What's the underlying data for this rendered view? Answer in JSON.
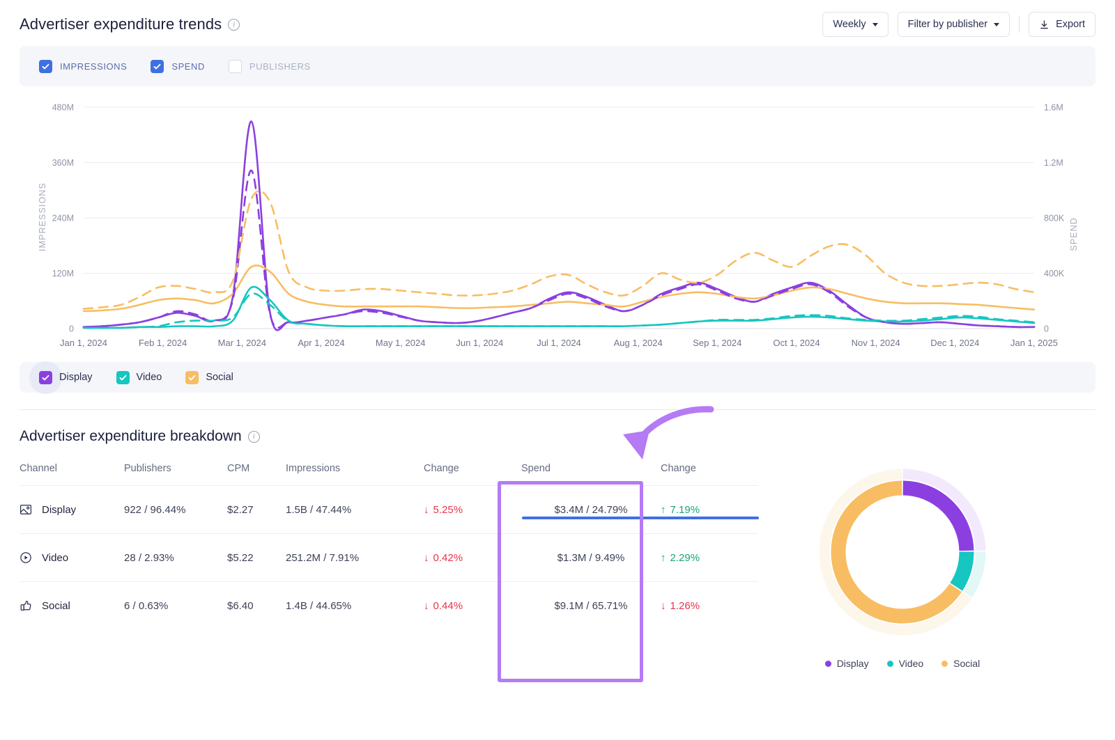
{
  "trends": {
    "title": "Advertiser expenditure trends",
    "info_icon": "info-icon",
    "controls": {
      "period_label": "Weekly",
      "filter_label": "Filter by publisher",
      "export_label": "Export",
      "export_icon": "download-icon"
    },
    "metrics": [
      {
        "label": "IMPRESSIONS",
        "checked": true
      },
      {
        "label": "SPEND",
        "checked": true
      },
      {
        "label": "PUBLISHERS",
        "checked": false
      }
    ],
    "channels": [
      {
        "label": "Display",
        "checked": true,
        "color": "#8b3fe0"
      },
      {
        "label": "Video",
        "checked": true,
        "color": "#16c6c0"
      },
      {
        "label": "Social",
        "checked": true,
        "color": "#f8bd62"
      }
    ]
  },
  "chart_data": {
    "type": "line",
    "title": "Advertiser expenditure trends",
    "xlabel": "",
    "ylabel": "IMPRESSIONS",
    "y2label": "SPEND",
    "grid": true,
    "legend": "bottom",
    "x": [
      "Jan 1, 2024",
      "Feb 1, 2024",
      "Mar 1, 2024",
      "Apr 1, 2024",
      "May 1, 2024",
      "Jun 1, 2024",
      "Jul 1, 2024",
      "Aug 1, 2024",
      "Sep 1, 2024",
      "Oct 1, 2024",
      "Nov 1, 2024",
      "Dec 1, 2024",
      "Jan 1, 2025"
    ],
    "yticks": [
      "0",
      "120M",
      "240M",
      "360M",
      "480M"
    ],
    "ylim": [
      0,
      480000000
    ],
    "y2ticks": [
      "0",
      "400K",
      "800K",
      "1.2M",
      "1.6M"
    ],
    "y2lim": [
      0,
      1600000
    ],
    "series": [
      {
        "name": "Display impressions",
        "axis": "left",
        "style": "solid",
        "color": "#8b3fe0",
        "values": [
          2,
          3,
          5,
          8,
          14,
          20,
          16,
          10,
          40,
          262,
          20,
          8,
          10,
          14,
          18,
          24,
          22,
          16,
          10,
          8,
          7,
          9,
          14,
          20,
          26,
          38,
          46,
          40,
          30,
          22,
          30,
          44,
          52,
          58,
          50,
          40,
          34,
          44,
          52,
          58,
          48,
          30,
          14,
          8,
          6,
          7,
          8,
          6,
          4,
          3,
          2,
          2
        ]
      },
      {
        "name": "Video impressions",
        "axis": "left",
        "style": "solid",
        "color": "#16c6c0",
        "values": [
          1,
          1,
          1,
          2,
          2,
          3,
          3,
          3,
          10,
          52,
          36,
          10,
          6,
          4,
          3,
          3,
          3,
          3,
          3,
          3,
          3,
          3,
          3,
          3,
          3,
          3,
          3,
          3,
          3,
          3,
          4,
          5,
          7,
          9,
          10,
          10,
          10,
          12,
          14,
          15,
          14,
          12,
          10,
          9,
          9,
          10,
          12,
          14,
          13,
          11,
          9,
          7
        ]
      },
      {
        "name": "Social impressions",
        "axis": "left",
        "style": "solid",
        "color": "#f8bd62",
        "values": [
          22,
          23,
          25,
          30,
          36,
          38,
          36,
          32,
          44,
          78,
          72,
          44,
          34,
          30,
          28,
          28,
          28,
          28,
          28,
          27,
          26,
          26,
          27,
          28,
          30,
          32,
          34,
          32,
          30,
          28,
          34,
          40,
          44,
          46,
          44,
          40,
          38,
          42,
          48,
          52,
          50,
          44,
          38,
          34,
          32,
          32,
          32,
          31,
          30,
          28,
          26,
          24
        ]
      },
      {
        "name": "Display spend",
        "axis": "right",
        "style": "dashed",
        "color": "#8b3fe0",
        "values": [
          2,
          3,
          5,
          8,
          14,
          22,
          18,
          10,
          36,
          200,
          18,
          8,
          10,
          14,
          18,
          22,
          20,
          15,
          10,
          8,
          7,
          9,
          14,
          20,
          26,
          36,
          44,
          38,
          28,
          22,
          30,
          42,
          50,
          56,
          48,
          38,
          34,
          42,
          50,
          56,
          46,
          28,
          14,
          8,
          6,
          7,
          8,
          6,
          4,
          3,
          2,
          2
        ]
      },
      {
        "name": "Video spend",
        "axis": "right",
        "style": "dashed",
        "color": "#16c6c0",
        "values": [
          1,
          1,
          1,
          2,
          3,
          8,
          10,
          10,
          14,
          44,
          30,
          9,
          6,
          4,
          3,
          3,
          3,
          3,
          3,
          3,
          3,
          3,
          3,
          3,
          3,
          3,
          3,
          3,
          3,
          3,
          4,
          5,
          7,
          9,
          11,
          11,
          11,
          13,
          16,
          17,
          16,
          13,
          11,
          10,
          10,
          12,
          14,
          16,
          15,
          12,
          10,
          8
        ]
      },
      {
        "name": "Social spend",
        "axis": "right",
        "style": "dashed",
        "color": "#f8bd62",
        "values": [
          25,
          27,
          30,
          40,
          52,
          54,
          50,
          46,
          60,
          164,
          160,
          72,
          52,
          48,
          48,
          50,
          50,
          48,
          46,
          44,
          42,
          42,
          44,
          48,
          56,
          66,
          68,
          56,
          46,
          42,
          54,
          70,
          62,
          58,
          68,
          86,
          96,
          86,
          78,
          92,
          104,
          106,
          92,
          70,
          58,
          54,
          54,
          56,
          58,
          56,
          50,
          46
        ]
      }
    ]
  },
  "breakdown": {
    "title": "Advertiser expenditure breakdown",
    "info_icon": "info-icon",
    "columns": [
      "Channel",
      "Publishers",
      "CPM",
      "Impressions",
      "Change",
      "Spend",
      "Change"
    ],
    "active_column": "Spend",
    "rows": [
      {
        "icon": "image-icon",
        "channel": "Display",
        "publishers": "922 / 96.44%",
        "cpm": "$2.27",
        "impressions": "1.5B / 47.44%",
        "impressions_change": "5.25%",
        "impressions_change_dir": "down",
        "spend": "$3.4M / 24.79%",
        "spend_change": "7.19%",
        "spend_change_dir": "up"
      },
      {
        "icon": "play-circle-icon",
        "channel": "Video",
        "publishers": "28 / 2.93%",
        "cpm": "$5.22",
        "impressions": "251.2M / 7.91%",
        "impressions_change": "0.42%",
        "impressions_change_dir": "down",
        "spend": "$1.3M / 9.49%",
        "spend_change": "2.29%",
        "spend_change_dir": "up"
      },
      {
        "icon": "thumbs-up-icon",
        "channel": "Social",
        "publishers": "6 / 0.63%",
        "cpm": "$6.40",
        "impressions": "1.4B / 44.65%",
        "impressions_change": "0.44%",
        "impressions_change_dir": "down",
        "spend": "$9.1M / 65.71%",
        "spend_change": "1.26%",
        "spend_change_dir": "down"
      }
    ],
    "donut": {
      "type": "pie",
      "title": "",
      "slices": [
        {
          "label": "Display",
          "value": 24.79,
          "color": "#8b3fe0",
          "track": "#f2e9fd"
        },
        {
          "label": "Video",
          "value": 9.49,
          "color": "#16c6c0",
          "track": "#e2f8f7"
        },
        {
          "label": "Social",
          "value": 65.71,
          "color": "#f8bd62",
          "track": "#fdf6ea"
        }
      ],
      "legend": [
        "Display",
        "Video",
        "Social"
      ]
    }
  },
  "annotation": {
    "arrow": "curved-arrow-icon",
    "highlight": "spend-column-highlight",
    "color": "#b47bf5"
  }
}
